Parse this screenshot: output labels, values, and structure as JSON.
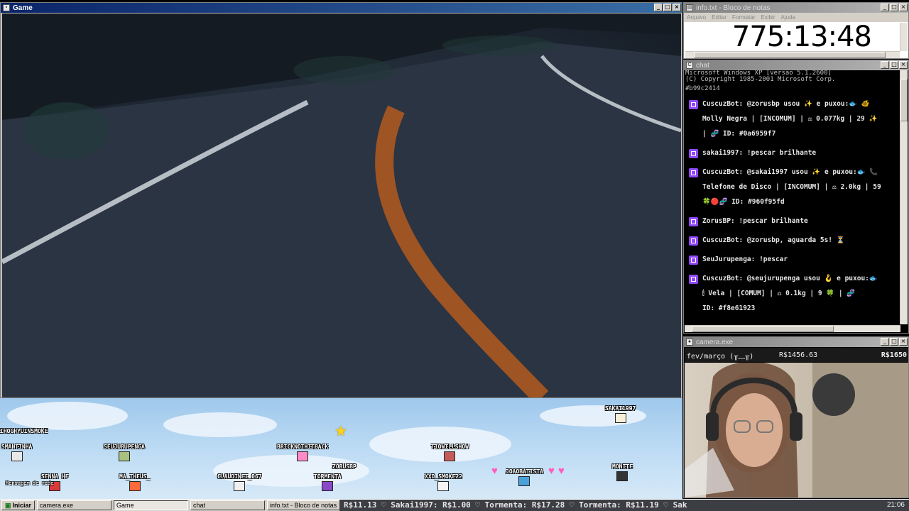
{
  "game": {
    "title": "Game"
  },
  "notepad": {
    "title": "info.txt - Bloco de notas",
    "menu": [
      "Arquivo",
      "Editar",
      "Formatar",
      "Exibir",
      "Ajuda"
    ],
    "timer": "775:13:48"
  },
  "chat": {
    "title": "chat",
    "header_lines": [
      "Microsoft Windows XP [versão 5.1.2600]",
      "(C) Copyright 1985-2001 Microsoft Corp.",
      "#b99c2414"
    ],
    "messages": [
      {
        "line1": "CuscuzBot: @zorusbp usou ✨ e puxou:🐟 🐠",
        "line2": "Molly Negra | [INCOMUM] | ⚖ 0.077kg | 29 ✨",
        "line3": "| 🧬 ID: #0a6959f7"
      },
      {
        "line1": "sakai1997: !pescar brilhante"
      },
      {
        "line1": "CuscuzBot: @sakai1997 usou ✨ e puxou:🐟 📞",
        "line2": "Telefone de Disco | [INCOMUM] | ⚖ 2.0kg | 59",
        "line3": "🍀🔴🧬 ID: #960f95fd"
      },
      {
        "line1": "ZorusBP: !pescar brilhante"
      },
      {
        "line1": "CuscuzBot: @zorusbp, aguarda 5s! ⏳"
      },
      {
        "line1": "SeuJurupenga: !pescar"
      },
      {
        "line1": "CuscuzBot: @seujurupenga usou 🪝 e puxou:🐟",
        "line2": "🕯 Vela | [COMUM] | ⚖ 0.1kg | 9 🍀 | 🧬",
        "line3": "ID: #f8e61923"
      }
    ]
  },
  "camera": {
    "title": "camera.exe",
    "label": "fev/março (╥﹏╥)",
    "amount": "R$1456.63",
    "goal": "R$1650"
  },
  "overlay": {
    "avatars": [
      {
        "name": "IHOGHYUINSMOKE"
      },
      {
        "name": "SMANTINHA"
      },
      {
        "name": "SEUJURUPENGA"
      },
      {
        "name": "BRICKNOTHITBACK"
      },
      {
        "name": "TIOWILLSHOW"
      },
      {
        "name": "SAKAI1997"
      },
      {
        "name": "SENNA HF"
      },
      {
        "name": "MA_THEUS_"
      },
      {
        "name": "CLAUDINEI_067"
      },
      {
        "name": "ZORUSBP"
      },
      {
        "name": "TORMENTA"
      },
      {
        "name": "XXD_SMOKE22"
      },
      {
        "name": "JOAOBATISTA"
      },
      {
        "name": "MONITE"
      }
    ],
    "caption": "Mensagem de rede"
  },
  "taskbar": {
    "start": "Iniciar",
    "tasks": [
      "camera.exe",
      "Game",
      "chat",
      "info.txt - Bloco de notas"
    ],
    "ticker": "R$11.13 ♡   Sakai1997: R$1.00 ♡   Tormenta: R$17.28 ♡   Tormenta: R$11.19 ♡   Sak",
    "clock": "21:06"
  },
  "colors": {
    "titlebar": "#0a246a",
    "twitch": "#9147ff",
    "road_line": "#c6651f"
  }
}
